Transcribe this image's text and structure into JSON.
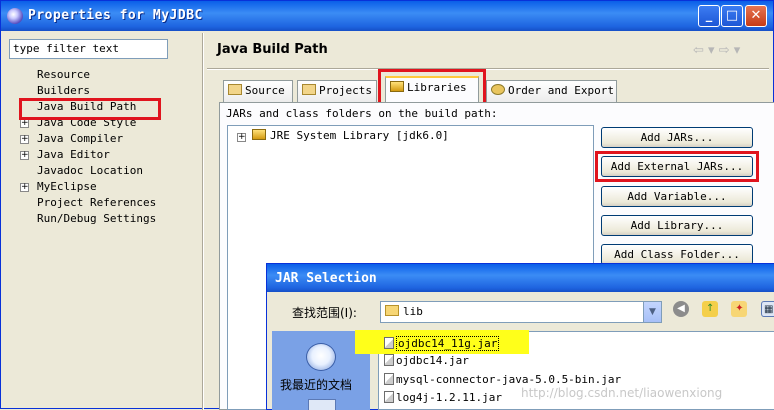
{
  "window": {
    "title": "Properties for MyJDBC",
    "minimize_label": "_",
    "maximize_label": "□",
    "close_label": "✕"
  },
  "filter": {
    "value": "type filter text"
  },
  "tree": {
    "items": [
      {
        "label": "Resource",
        "expandable": false
      },
      {
        "label": "Builders",
        "expandable": false
      },
      {
        "label": "Java Build Path",
        "expandable": false,
        "selected": true
      },
      {
        "label": "Java Code Style",
        "expandable": true
      },
      {
        "label": "Java Compiler",
        "expandable": true
      },
      {
        "label": "Java Editor",
        "expandable": true
      },
      {
        "label": "Javadoc Location",
        "expandable": false
      },
      {
        "label": "MyEclipse",
        "expandable": true
      },
      {
        "label": "Project References",
        "expandable": false
      },
      {
        "label": "Run/Debug Settings",
        "expandable": false
      }
    ]
  },
  "page": {
    "title": "Java Build Path",
    "nav_back": "⇦",
    "nav_forward": "⇨"
  },
  "tabs": [
    {
      "label": "Source",
      "icon": "source-folder-icon"
    },
    {
      "label": "Projects",
      "icon": "projects-icon"
    },
    {
      "label": "Libraries",
      "icon": "libraries-icon",
      "active": true
    },
    {
      "label": "Order and Export",
      "icon": "order-export-icon"
    }
  ],
  "libraries": {
    "heading": "JARs and class folders on the build path:",
    "entries": [
      {
        "label": "JRE System Library [jdk6.0]",
        "icon": "library-icon"
      }
    ]
  },
  "buttons": {
    "add_jars": "Add JARs...",
    "add_external_jars": "Add External JARs...",
    "add_variable": "Add Variable...",
    "add_library": "Add Library...",
    "add_class_folder": "Add Class Folder..."
  },
  "dialog": {
    "title": "JAR Selection",
    "look_in_label": "查找范围(I):",
    "look_in_value": "lib",
    "places": [
      {
        "label": "我最近的文档",
        "icon": "recent-documents-icon"
      }
    ],
    "files": [
      "ojdbc14_11g.jar",
      "ojdbc14.jar",
      "mysql-connector-java-5.0.5-bin.jar",
      "log4j-1.2.11.jar"
    ]
  },
  "watermark": "http://blog.csdn.net/liaowenxiong",
  "colors": {
    "title_bar": "#0a5ee8",
    "highlight_box": "#e0141e",
    "file_highlight": "#ffff1a",
    "tab_accent": "#ffc83c"
  }
}
